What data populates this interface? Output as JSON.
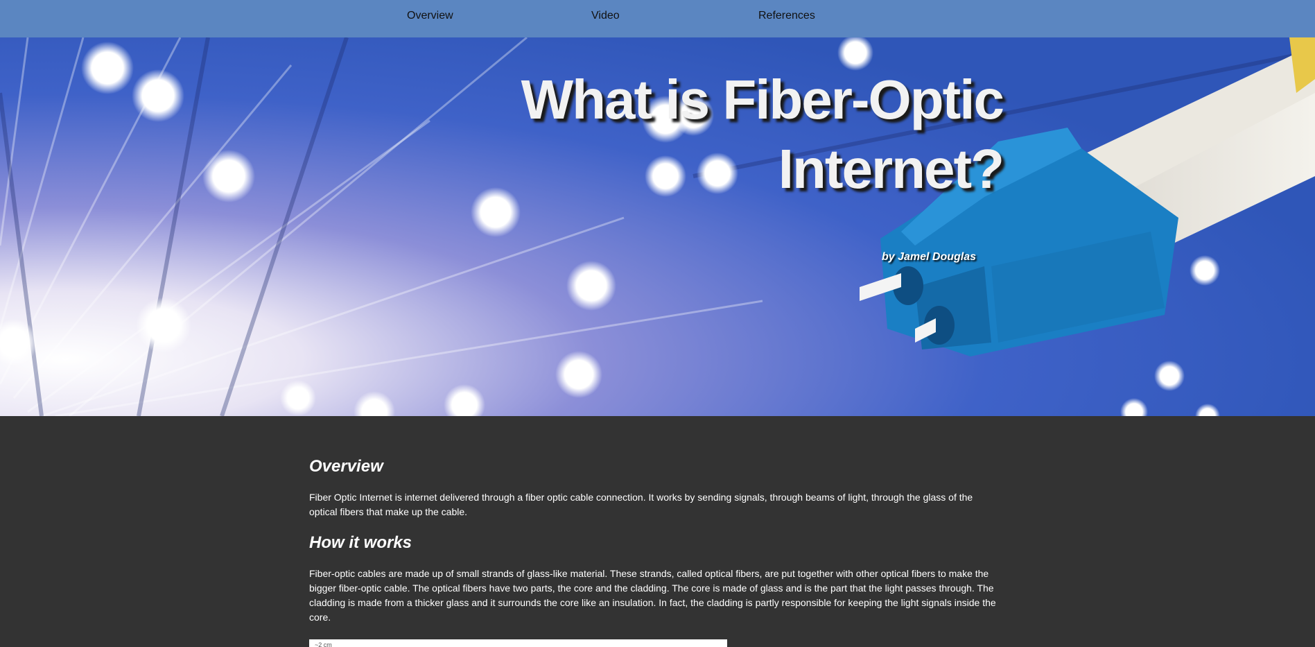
{
  "nav": {
    "items": [
      {
        "label": "Overview"
      },
      {
        "label": "Video"
      },
      {
        "label": "References"
      }
    ],
    "background": "#5b86c1"
  },
  "hero": {
    "title_line1": "What is Fiber-Optic",
    "title_line2": "Internet?",
    "author": "by Jamel Douglas"
  },
  "sections": {
    "overview": {
      "heading": "Overview",
      "text": "Fiber Optic Internet is internet delivered through a fiber optic cable connection. It works by sending signals, through beams of light, through the glass of the optical fibers that make up the cable."
    },
    "how_it_works": {
      "heading": "How it works",
      "text": "Fiber-optic cables are made up of small strands of glass-like material. These strands, called optical fibers, are put together with other optical fibers to make the bigger fiber-optic cable. The optical fibers have two parts, the core and the cladding. The core is made of glass and is the part that the light passes through. The cladding is made from a thicker glass and it surrounds the core like an insulation. In fact, the cladding is partly responsible for keeping the light signals inside the core."
    }
  },
  "diagram": {
    "label": "~2 cm"
  },
  "colors": {
    "page_background": "#333333",
    "connector_blue": "#1a7fc4",
    "hero_blue": "#3a5fc4"
  }
}
